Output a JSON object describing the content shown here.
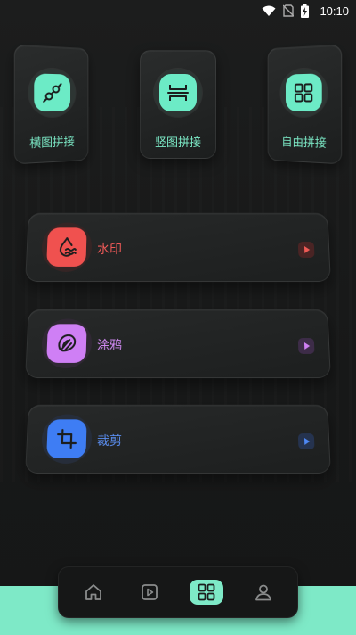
{
  "status_bar": {
    "time": "10:10",
    "icons": [
      "wifi-icon",
      "no-sim-icon",
      "battery-charging-icon"
    ]
  },
  "top_cards": [
    {
      "label": "横图拼接",
      "icon": "horizontal-stitch-icon"
    },
    {
      "label": "竖图拼接",
      "icon": "vertical-stitch-icon"
    },
    {
      "label": "自由拼接",
      "icon": "free-grid-icon"
    }
  ],
  "list_items": [
    {
      "label": "水印",
      "icon": "watermark-icon",
      "color": "#f0514f",
      "label_color": "#f05a58",
      "arrow_bg": "#4a2424",
      "arrow_color": "#ee5a55"
    },
    {
      "label": "涂鸦",
      "icon": "doodle-icon",
      "color": "#cf7ff5",
      "label_color": "#d38bf5",
      "arrow_bg": "#3d2c48",
      "arrow_color": "#cf80f3"
    },
    {
      "label": "裁剪",
      "icon": "crop-icon",
      "color": "#3e7df4",
      "label_color": "#5b8ff3",
      "arrow_bg": "#25334f",
      "arrow_color": "#4e88f4"
    }
  ],
  "bottom_nav": {
    "items": [
      "home-icon",
      "video-icon",
      "tools-icon",
      "profile-icon"
    ],
    "active": "tools-icon"
  },
  "colors": {
    "accent": "#7ee9c7",
    "background": "#1a1b1b"
  }
}
